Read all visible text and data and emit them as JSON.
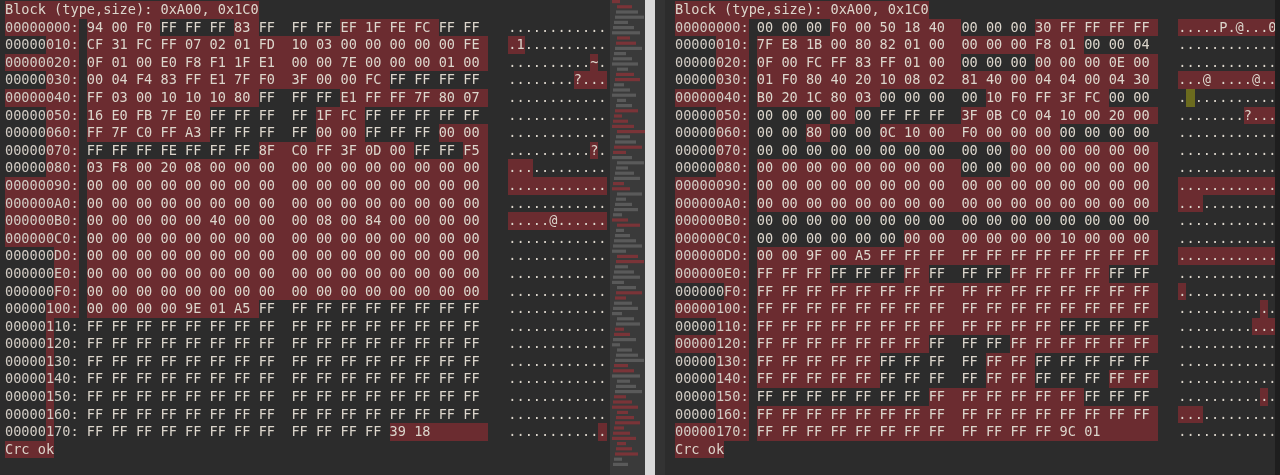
{
  "panes": [
    {
      "header": {
        "text": "Block (type,size): 0xA00, 0x1C0",
        "changed": true
      },
      "rows": [
        {
          "address": [
            {
              "text": "00000000:",
              "changed": true
            }
          ],
          "hex": [
            {
              "text": "94 00 F0",
              "changed": true
            },
            {
              "text": "FF FF FF",
              "changed": false
            },
            {
              "text": "83",
              "changed": true
            },
            {
              "text": "FF FF FF",
              "changed": false
            },
            {
              "text": "EF 1F FE FC",
              "changed": true
            },
            {
              "text": "FF FF",
              "changed": false
            }
          ],
          "ascii": [
            {
              "text": "............",
              "kind": "plain"
            }
          ]
        },
        {
          "address": [
            {
              "text": "00000",
              "changed": false
            },
            {
              "text": "010:",
              "changed": true
            }
          ],
          "hex": [
            {
              "text": "CF 31 FC FF 07 02 01 FD 10 03 00 00 00 00 00 FE",
              "changed": true
            }
          ],
          "ascii": [
            {
              "text": ".1",
              "kind": "changed"
            },
            {
              "text": "..........",
              "kind": "plain"
            }
          ]
        },
        {
          "address": [
            {
              "text": "00000020:",
              "changed": true
            }
          ],
          "hex": [
            {
              "text": "0F 01 00 E0 F8 F1 1F E1 00 00 7E 00 00 00 01 00",
              "changed": true
            }
          ],
          "ascii": [
            {
              "text": "..........",
              "kind": "plain"
            },
            {
              "text": "~",
              "kind": "changed"
            },
            {
              "text": ".",
              "kind": "plain"
            }
          ]
        },
        {
          "address": [
            {
              "text": "00000",
              "changed": false
            },
            {
              "text": "030:",
              "changed": true
            }
          ],
          "hex": [
            {
              "text": "00 04 F4 83 FF E1 7F F0 3F 00 00 FC",
              "changed": true
            },
            {
              "text": "FF FF FF FF",
              "changed": false
            }
          ],
          "ascii": [
            {
              "text": "........",
              "kind": "plain"
            },
            {
              "text": "?...",
              "kind": "changed"
            }
          ]
        },
        {
          "address": [
            {
              "text": "00000040:",
              "changed": true
            }
          ],
          "hex": [
            {
              "text": "FF 03 00 10 10 10 80",
              "changed": true
            },
            {
              "text": "FF FF FF",
              "changed": false
            },
            {
              "text": "E1 FF FF 7F 80 07",
              "changed": true
            }
          ],
          "ascii": [
            {
              "text": "............",
              "kind": "plain"
            }
          ]
        },
        {
          "address": [
            {
              "text": "00000",
              "changed": false
            },
            {
              "text": "050:",
              "changed": true
            }
          ],
          "hex": [
            {
              "text": "16 E0 FB 7F E0",
              "changed": true
            },
            {
              "text": "FF FF FF FF",
              "changed": false
            },
            {
              "text": "1F FC",
              "changed": true
            },
            {
              "text": "FF FF FF FF FF",
              "changed": false
            }
          ],
          "ascii": [
            {
              "text": "............",
              "kind": "plain"
            }
          ]
        },
        {
          "address": [
            {
              "text": "00000",
              "changed": false
            },
            {
              "text": "060:",
              "changed": true
            }
          ],
          "hex": [
            {
              "text": "FF 7F C0 FF A3",
              "changed": true
            },
            {
              "text": "FF FF FF FF",
              "changed": false
            },
            {
              "text": "00 00",
              "changed": true
            },
            {
              "text": "FF FF FF",
              "changed": false
            },
            {
              "text": "00 00",
              "changed": true
            }
          ],
          "ascii": [
            {
              "text": "............",
              "kind": "plain"
            }
          ]
        },
        {
          "address": [
            {
              "text": "00000",
              "changed": false
            },
            {
              "text": "070:",
              "changed": true
            }
          ],
          "hex": [
            {
              "text": "FF FF FF FE FF FF FF",
              "changed": false
            },
            {
              "text": "8F C0 FF 3F 0D 00",
              "changed": true
            },
            {
              "text": "FF FF",
              "changed": false
            },
            {
              "text": "F5",
              "changed": true
            }
          ],
          "ascii": [
            {
              "text": "..........",
              "kind": "plain"
            },
            {
              "text": "?",
              "kind": "changed"
            },
            {
              "text": ".",
              "kind": "plain"
            }
          ]
        },
        {
          "address": [
            {
              "text": "00000",
              "changed": false
            },
            {
              "text": "080:",
              "changed": true
            }
          ],
          "hex": [
            {
              "text": "03 F8 00 20 08 00 00 00 00 00 00 00 00 00 00 00",
              "changed": true
            }
          ],
          "ascii": [
            {
              "text": "...",
              "kind": "changed"
            },
            {
              "text": ".........",
              "kind": "plain"
            }
          ]
        },
        {
          "address": [
            {
              "text": "00000090:",
              "changed": true
            }
          ],
          "hex": [
            {
              "text": "00 00 00 00 00 00 00 00 00 00 00 00 00 00 00 00",
              "changed": true
            }
          ],
          "ascii": [
            {
              "text": "............",
              "kind": "changed"
            }
          ]
        },
        {
          "address": [
            {
              "text": "000000A0:",
              "changed": true
            }
          ],
          "hex": [
            {
              "text": "00 00 00 00 00 00 00 00 00 00 00 00 00 00 00 00",
              "changed": true
            }
          ],
          "ascii": [
            {
              "text": "............",
              "kind": "plain"
            }
          ]
        },
        {
          "address": [
            {
              "text": "000000B0:",
              "changed": true
            }
          ],
          "hex": [
            {
              "text": "00 00 00 00 00 40 00 00 00 08 00 84 00 00 00 00",
              "changed": true
            }
          ],
          "ascii": [
            {
              "text": ".....@......",
              "kind": "changed"
            }
          ]
        },
        {
          "address": [
            {
              "text": "000000C0:",
              "changed": true
            }
          ],
          "hex": [
            {
              "text": "00 00 00 00 00 00 00 00 00 00 00 00 00 00 00 00",
              "changed": true
            }
          ],
          "ascii": [
            {
              "text": "............",
              "kind": "plain"
            }
          ]
        },
        {
          "address": [
            {
              "text": "000000",
              "changed": false
            },
            {
              "text": "D0:",
              "changed": true
            }
          ],
          "hex": [
            {
              "text": "00 00 00 00 00 00 00 00 00 00 00 00 00 00 00 00",
              "changed": true
            }
          ],
          "ascii": [
            {
              "text": "............",
              "kind": "plain"
            }
          ]
        },
        {
          "address": [
            {
              "text": "000000",
              "changed": false
            },
            {
              "text": "E0:",
              "changed": true
            }
          ],
          "hex": [
            {
              "text": "00 00 00 00 00 00 00 00 00 00 00 00 00 00 00 00",
              "changed": true
            }
          ],
          "ascii": [
            {
              "text": "............",
              "kind": "plain"
            }
          ]
        },
        {
          "address": [
            {
              "text": "000000",
              "changed": false
            },
            {
              "text": "F0:",
              "changed": true
            }
          ],
          "hex": [
            {
              "text": "00 00 00 00 00 00 00 00 00 00 00 00 00 00 00 00",
              "changed": true
            }
          ],
          "ascii": [
            {
              "text": "............",
              "kind": "plain"
            }
          ]
        },
        {
          "address": [
            {
              "text": "00000",
              "changed": false
            },
            {
              "text": "100:",
              "changed": true
            }
          ],
          "hex": [
            {
              "text": "00 00 00 00 9E 01 A5",
              "changed": true
            },
            {
              "text": "FF FF FF FF FF FF FF FF FF",
              "changed": false
            }
          ],
          "ascii": [
            {
              "text": "............",
              "kind": "plain"
            }
          ]
        },
        {
          "address": [
            {
              "text": "00000",
              "changed": false
            },
            {
              "text": "1",
              "changed": true
            },
            {
              "text": "10:",
              "changed": false
            }
          ],
          "hex": [
            {
              "text": "FF FF FF FF FF FF FF FF FF FF FF FF FF FF FF FF",
              "changed": false
            }
          ],
          "ascii": [
            {
              "text": "............",
              "kind": "plain"
            }
          ]
        },
        {
          "address": [
            {
              "text": "00000",
              "changed": false
            },
            {
              "text": "1",
              "changed": true
            },
            {
              "text": "20:",
              "changed": false
            }
          ],
          "hex": [
            {
              "text": "FF FF FF FF FF FF FF FF FF FF FF FF FF FF FF FF",
              "changed": false
            }
          ],
          "ascii": [
            {
              "text": "............",
              "kind": "plain"
            }
          ]
        },
        {
          "address": [
            {
              "text": "00000",
              "changed": false
            },
            {
              "text": "1",
              "changed": true
            },
            {
              "text": "30:",
              "changed": false
            }
          ],
          "hex": [
            {
              "text": "FF FF FF FF FF FF FF FF FF FF FF FF FF FF FF FF",
              "changed": false
            }
          ],
          "ascii": [
            {
              "text": "............",
              "kind": "plain"
            }
          ]
        },
        {
          "address": [
            {
              "text": "00000",
              "changed": false
            },
            {
              "text": "1",
              "changed": true
            },
            {
              "text": "40:",
              "changed": false
            }
          ],
          "hex": [
            {
              "text": "FF FF FF FF FF FF FF FF FF FF FF FF FF FF FF FF",
              "changed": false
            }
          ],
          "ascii": [
            {
              "text": "............",
              "kind": "plain"
            }
          ]
        },
        {
          "address": [
            {
              "text": "00000",
              "changed": false
            },
            {
              "text": "1",
              "changed": true
            },
            {
              "text": "50:",
              "changed": false
            }
          ],
          "hex": [
            {
              "text": "FF FF FF FF FF FF FF FF FF FF FF FF FF FF FF FF",
              "changed": false
            }
          ],
          "ascii": [
            {
              "text": "............",
              "kind": "plain"
            }
          ]
        },
        {
          "address": [
            {
              "text": "00000",
              "changed": false
            },
            {
              "text": "1",
              "changed": true
            },
            {
              "text": "60:",
              "changed": false
            }
          ],
          "hex": [
            {
              "text": "FF FF FF FF FF FF FF FF FF FF FF FF FF FF FF FF",
              "changed": false
            }
          ],
          "ascii": [
            {
              "text": "............",
              "kind": "plain"
            }
          ]
        },
        {
          "address": [
            {
              "text": "00000",
              "changed": false
            },
            {
              "text": "1",
              "changed": true
            },
            {
              "text": "70:",
              "changed": false
            }
          ],
          "hex": [
            {
              "text": "FF FF FF FF FF FF FF FF FF FF FF FF",
              "changed": false
            },
            {
              "text": "39 18",
              "changed": true
            }
          ],
          "ascii": [
            {
              "text": "...........",
              "kind": "plain"
            },
            {
              "text": ".",
              "kind": "changed"
            }
          ]
        }
      ],
      "footer": {
        "text": "Crc ok",
        "changed": true
      }
    },
    {
      "header": {
        "text": "Block (type,size): 0xA00, 0x1C0",
        "changed": true
      },
      "rows": [
        {
          "address": [
            {
              "text": "00000000:",
              "changed": true
            }
          ],
          "hex": [
            {
              "text": "00 00 00",
              "changed": false
            },
            {
              "text": "F0 00 50 18 40",
              "changed": true
            },
            {
              "text": "00 00 00",
              "changed": false
            },
            {
              "text": "30 FF FF FF FF",
              "changed": true
            }
          ],
          "ascii": [
            {
              "text": ".....P.@...0",
              "kind": "changed"
            }
          ]
        },
        {
          "address": [
            {
              "text": "00000",
              "changed": false
            },
            {
              "text": "010:",
              "changed": true
            }
          ],
          "hex": [
            {
              "text": "7F E8 1B 00 80 82 01 00 00 00 00 F8 01",
              "changed": true
            },
            {
              "text": "00 00 04",
              "changed": false
            }
          ],
          "ascii": [
            {
              "text": "............",
              "kind": "plain"
            }
          ]
        },
        {
          "address": [
            {
              "text": "00000",
              "changed": false
            },
            {
              "text": "020:",
              "changed": true
            }
          ],
          "hex": [
            {
              "text": "0F 00 FC FF 83 FF 01 00",
              "changed": true
            },
            {
              "text": "00 00 00",
              "changed": false
            },
            {
              "text": "00 00 00 0E 00",
              "changed": true
            }
          ],
          "ascii": [
            {
              "text": "............",
              "kind": "plain"
            }
          ]
        },
        {
          "address": [
            {
              "text": "00000",
              "changed": false
            },
            {
              "text": "030:",
              "changed": true
            }
          ],
          "hex": [
            {
              "text": "01 F0 80 40 20 10 08 02 81 40 00 04 04 00 04 30",
              "changed": true
            }
          ],
          "ascii": [
            {
              "text": "...@ ....@..",
              "kind": "changed"
            }
          ]
        },
        {
          "address": [
            {
              "text": "00000040:",
              "changed": true
            }
          ],
          "hex": [
            {
              "text": "B0 20 1C 80 03",
              "changed": true
            },
            {
              "text": "00 00 00 00",
              "changed": false
            },
            {
              "text": "10 F0 FF 3F FC",
              "changed": true
            },
            {
              "text": "00 00",
              "changed": false
            }
          ],
          "ascii": [
            {
              "text": ".",
              "kind": "plain"
            },
            {
              "kind": "cursor"
            },
            {
              "text": "..........",
              "kind": "plain"
            }
          ]
        },
        {
          "address": [
            {
              "text": "00000",
              "changed": false
            },
            {
              "text": "050:",
              "changed": true
            }
          ],
          "hex": [
            {
              "text": "00 00 00",
              "changed": false
            },
            {
              "text": "00",
              "changed": true
            },
            {
              "text": "00 FF FF FF",
              "changed": false
            },
            {
              "text": "3F 0B C0 04 10 00 20 00",
              "changed": true
            }
          ],
          "ascii": [
            {
              "text": "........",
              "kind": "plain"
            },
            {
              "text": "?...",
              "kind": "changed"
            }
          ]
        },
        {
          "address": [
            {
              "text": "00000",
              "changed": false
            },
            {
              "text": "060:",
              "changed": true
            }
          ],
          "hex": [
            {
              "text": "00 00",
              "changed": false
            },
            {
              "text": "80",
              "changed": true
            },
            {
              "text": "00 00",
              "changed": false
            },
            {
              "text": "0C 10 00 F0 00 00 00",
              "changed": true
            },
            {
              "text": "00 00 00 00",
              "changed": false
            }
          ],
          "ascii": [
            {
              "text": "............",
              "kind": "plain"
            }
          ]
        },
        {
          "address": [
            {
              "text": "00000",
              "changed": false
            },
            {
              "text": "070:",
              "changed": true
            }
          ],
          "hex": [
            {
              "text": "00 00 00 00 00 00 00 00 00 00",
              "changed": false
            },
            {
              "text": "00 00 00 00 00 00",
              "changed": true
            }
          ],
          "ascii": [
            {
              "text": "............",
              "kind": "plain"
            }
          ]
        },
        {
          "address": [
            {
              "text": "00000",
              "changed": false
            },
            {
              "text": "080:",
              "changed": true
            }
          ],
          "hex": [
            {
              "text": "00 00 00 00 00 00 00 00",
              "changed": true
            },
            {
              "text": "00 00",
              "changed": false
            },
            {
              "text": "00 00 00 00 00 00",
              "changed": true
            }
          ],
          "ascii": [
            {
              "text": "............",
              "kind": "plain"
            }
          ]
        },
        {
          "address": [
            {
              "text": "00000090:",
              "changed": true
            }
          ],
          "hex": [
            {
              "text": "00 00 00 00 00 00 00 00 00 00 00 00 00 00 00 00",
              "changed": true
            }
          ],
          "ascii": [
            {
              "text": "............",
              "kind": "changed"
            }
          ]
        },
        {
          "address": [
            {
              "text": "000000A0:",
              "changed": true
            }
          ],
          "hex": [
            {
              "text": "00 00 00 00 00 00 00 00 00 00 00 00 00 00 00 00",
              "changed": true
            }
          ],
          "ascii": [
            {
              "text": "...",
              "kind": "changed"
            },
            {
              "text": ".........",
              "kind": "plain"
            }
          ]
        },
        {
          "address": [
            {
              "text": "000000B0:",
              "changed": true
            }
          ],
          "hex": [
            {
              "text": "00 00 00 00 00 00 00 00 00 00 00 00 00 00 00 00",
              "changed": false
            }
          ],
          "ascii": [
            {
              "text": "............",
              "kind": "plain"
            }
          ]
        },
        {
          "address": [
            {
              "text": "000000C0:",
              "changed": true
            }
          ],
          "hex": [
            {
              "text": "00 00 00 00 00 00",
              "changed": false
            },
            {
              "text": "00 00 00 00 00 00 10 00 00 00",
              "changed": true
            }
          ],
          "ascii": [
            {
              "text": "............",
              "kind": "plain"
            }
          ]
        },
        {
          "address": [
            {
              "text": "000000D0:",
              "changed": true
            }
          ],
          "hex": [
            {
              "text": "00 00 9F 00 A5 FF FF FF FF FF FF FF FF FF FF FF",
              "changed": true
            }
          ],
          "ascii": [
            {
              "text": "............",
              "kind": "changed"
            }
          ]
        },
        {
          "address": [
            {
              "text": "000000E0:",
              "changed": true
            }
          ],
          "hex": [
            {
              "text": "FF FF FF",
              "changed": true
            },
            {
              "text": "FF FF FF",
              "changed": false
            },
            {
              "text": "FF",
              "changed": true
            },
            {
              "text": "FF FF FF",
              "changed": false
            },
            {
              "text": "FF FF FF FF",
              "changed": true
            },
            {
              "text": "FF FF",
              "changed": false
            }
          ],
          "ascii": [
            {
              "text": "............",
              "kind": "plain"
            }
          ]
        },
        {
          "address": [
            {
              "text": "000000",
              "changed": false
            },
            {
              "text": "F0:",
              "changed": true
            }
          ],
          "hex": [
            {
              "text": "FF FF FF FF FF FF FF FF FF FF FF FF FF FF FF FF",
              "changed": true
            }
          ],
          "ascii": [
            {
              "text": ".",
              "kind": "changed"
            },
            {
              "text": "...........",
              "kind": "plain"
            }
          ]
        },
        {
          "address": [
            {
              "text": "00000100:",
              "changed": true
            }
          ],
          "hex": [
            {
              "text": "FF FF FF FF FF FF FF FF FF FF FF FF FF FF FF FF",
              "changed": true
            }
          ],
          "ascii": [
            {
              "text": "..........",
              "kind": "plain"
            },
            {
              "text": ".",
              "kind": "changed"
            },
            {
              "text": ".",
              "kind": "plain"
            }
          ]
        },
        {
          "address": [
            {
              "text": "00000",
              "changed": false
            },
            {
              "text": "110:",
              "changed": true
            }
          ],
          "hex": [
            {
              "text": "FF FF FF FF FF FF FF FF FF FF FF FF",
              "changed": true
            },
            {
              "text": "FF FF FF FF",
              "changed": false
            }
          ],
          "ascii": [
            {
              "text": ".........",
              "kind": "plain"
            },
            {
              "text": "...",
              "kind": "changed"
            }
          ]
        },
        {
          "address": [
            {
              "text": "00000120:",
              "changed": true
            }
          ],
          "hex": [
            {
              "text": "FF FF FF FF FF FF FF",
              "changed": true
            },
            {
              "text": "FF FF FF",
              "changed": false
            },
            {
              "text": "FF FF FF FF FF FF",
              "changed": true
            }
          ],
          "ascii": [
            {
              "text": "............",
              "kind": "plain"
            }
          ]
        },
        {
          "address": [
            {
              "text": "00000",
              "changed": false
            },
            {
              "text": "130:",
              "changed": true
            }
          ],
          "hex": [
            {
              "text": "FF FF FF FF FF",
              "changed": true
            },
            {
              "text": "FF FF FF FF",
              "changed": false
            },
            {
              "text": "FF FF",
              "changed": true
            },
            {
              "text": "FF FF FF FF FF",
              "changed": false
            }
          ],
          "ascii": [
            {
              "text": "............",
              "kind": "plain"
            }
          ]
        },
        {
          "address": [
            {
              "text": "00000",
              "changed": false
            },
            {
              "text": "140:",
              "changed": true
            }
          ],
          "hex": [
            {
              "text": "FF FF FF FF FF",
              "changed": true
            },
            {
              "text": "FF FF FF FF",
              "changed": false
            },
            {
              "text": "FF FF",
              "changed": true
            },
            {
              "text": "FF FF FF",
              "changed": false
            },
            {
              "text": "FF FF",
              "changed": true
            }
          ],
          "ascii": [
            {
              "text": "............",
              "kind": "plain"
            }
          ]
        },
        {
          "address": [
            {
              "text": "00000",
              "changed": false
            },
            {
              "text": "150:",
              "changed": true
            }
          ],
          "hex": [
            {
              "text": "FF FF FF FF FF FF FF",
              "changed": false
            },
            {
              "text": "FF FF FF FF FF FF",
              "changed": true
            },
            {
              "text": "FF FF FF",
              "changed": false
            }
          ],
          "ascii": [
            {
              "text": "..........",
              "kind": "plain"
            },
            {
              "text": ".",
              "kind": "changed"
            },
            {
              "text": ".",
              "kind": "plain"
            }
          ]
        },
        {
          "address": [
            {
              "text": "00000",
              "changed": false
            },
            {
              "text": "160:",
              "changed": true
            }
          ],
          "hex": [
            {
              "text": "FF FF FF FF FF FF FF FF FF FF FF FF FF FF FF FF",
              "changed": true
            }
          ],
          "ascii": [
            {
              "text": "...",
              "kind": "changed"
            },
            {
              "text": ".........",
              "kind": "plain"
            }
          ]
        },
        {
          "address": [
            {
              "text": "00000170:",
              "changed": true
            }
          ],
          "hex": [
            {
              "text": "FF FF FF FF FF FF FF FF FF FF FF FF 9C 01",
              "changed": true
            }
          ],
          "ascii": [
            {
              "text": "............",
              "kind": "plain"
            }
          ]
        }
      ],
      "footer": {
        "text": "Crc ok",
        "changed": true
      }
    }
  ]
}
